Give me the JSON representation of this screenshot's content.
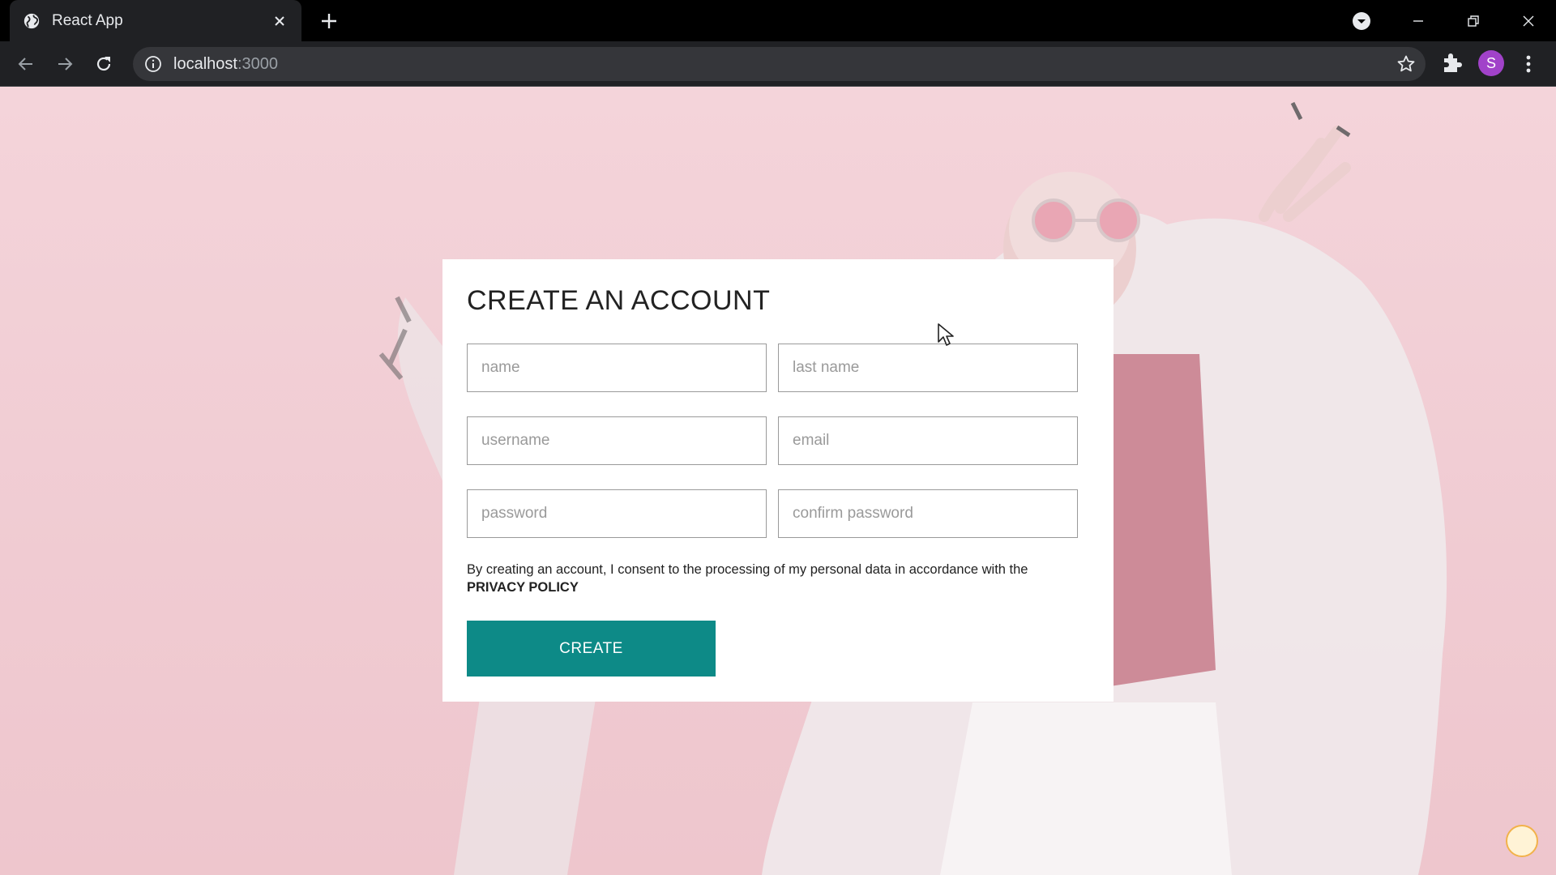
{
  "browser": {
    "tab_title": "React App",
    "url_host": "localhost",
    "url_port": ":3000",
    "profile_initial": "S",
    "icons": [
      "globe-icon",
      "close-icon",
      "plus-icon",
      "back-icon",
      "forward-icon",
      "reload-icon",
      "info-icon",
      "star-icon",
      "puzzle-icon",
      "kebab-menu-icon",
      "minimize-icon",
      "restore-icon",
      "window-close-icon"
    ]
  },
  "form": {
    "title": "CREATE AN ACCOUNT",
    "fields": {
      "name": "name",
      "last_name": "last name",
      "username": "username",
      "email": "email",
      "password": "password",
      "confirm_password": "confirm password"
    },
    "agreement_text": "By creating an account, I consent to the processing of my personal data in accordance with the ",
    "agreement_link": "PRIVACY POLICY",
    "submit_label": "CREATE"
  },
  "colors": {
    "accent": "#0d8a87",
    "page_background": "#f4d4da",
    "avatar": "#a142c9"
  }
}
